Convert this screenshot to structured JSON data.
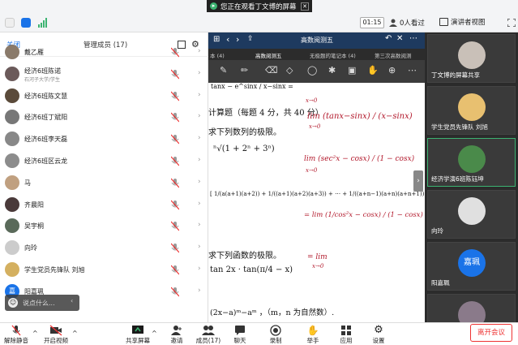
{
  "banner": {
    "text": "您正在观看丁文博的屏幕"
  },
  "topbar": {
    "time": "01:15",
    "viewers": "0人看过",
    "view_mode": "演讲者视图"
  },
  "panel": {
    "close_label": "关闭",
    "title": "管理成员 (17)",
    "members": [
      {
        "name": "戴乙雁",
        "sub": "",
        "avatar_color": "#8a7a6a"
      },
      {
        "name": "经济6班陈诺",
        "sub": "石河子大学/学生",
        "avatar_color": "#6b5a5a"
      },
      {
        "name": "经济6班陈文慧",
        "sub": "",
        "avatar_color": "#5a4a3a"
      },
      {
        "name": "经济6班丁斌阳",
        "sub": "",
        "avatar_color": "#777777"
      },
      {
        "name": "经济6班李天磊",
        "sub": "",
        "avatar_color": "#888888"
      },
      {
        "name": "经济6班区云龙",
        "sub": "",
        "avatar_color": "#8c8c8c"
      },
      {
        "name": "马",
        "sub": "",
        "avatar_color": "#c0a080"
      },
      {
        "name": "齐晨阳",
        "sub": "",
        "avatar_color": "#4a3a3a"
      },
      {
        "name": "吴宇桐",
        "sub": "",
        "avatar_color": "#5a6a5a"
      },
      {
        "name": "向玲",
        "sub": "",
        "avatar_color": "#cccccc"
      },
      {
        "name": "学生党员先锋队 刘旭",
        "sub": "",
        "avatar_color": "#d4b060"
      },
      {
        "name": "阳嘉珮",
        "sub": "",
        "avatar_initial": "嘉",
        "avatar_color": "#1a73e8"
      }
    ],
    "chat_placeholder": "说点什么..."
  },
  "slide": {
    "title": "高数阅测五",
    "tabs": [
      "本 (4)",
      "高数阅测五",
      "无极题的笔记本 (4)",
      "第三次高数阅测"
    ],
    "formula_top": "tanx − e^sinx / x−sinx =",
    "section_heading": "计算题（每题 4 分，共 40 分）",
    "q1": "求下列数列的极限。",
    "q1_expr": "ⁿ√(1 + 2ⁿ + 3ⁿ)",
    "series": "[ 1/(a(a+1)(a+2)) + 1/((a+1)(a+2)(a+3)) + ⋯ + 1/((a+n−1)(a+n)(a+n+1)) ]",
    "q2": "求下列函数的极限。",
    "q2_expr": "tan 2x · tan(π/4 − x)",
    "q3_expr": "(2x−a)ᵐ−aᵐ ，（m，n 为自然数）.",
    "handwriting": {
      "h1": "lim  (tanx−sinx) / (x−sinx)",
      "h1b": "x→0",
      "h2": "lim  (sec²x − cosx) / (1 − cosx)",
      "h2b": "x→0",
      "h3": "= lim  (1/cos²x − cosx) / (1 − cosx)",
      "h4": "= lim",
      "h4b": "x→0",
      "small1": "x→0"
    }
  },
  "videos": [
    {
      "label": "丁文博的屏幕共享",
      "color": "#c9c0b8"
    },
    {
      "label": "学生党员先锋队 刘旭",
      "color": "#e8c070"
    },
    {
      "label": "经济学演6班陈钰坤",
      "color": "#4a8a4a",
      "active": true
    },
    {
      "label": "向玲",
      "color": "#e0e0e0"
    },
    {
      "label": "阳嘉珮",
      "initial": "嘉珮",
      "color": "#1a73e8"
    },
    {
      "label": "",
      "color": "#8a7a8a"
    }
  ],
  "toolbar": {
    "mute": "解除静音",
    "video": "开启视频",
    "share": "共享屏幕",
    "invite": "邀请",
    "members": "成员(17)",
    "chat": "聊天",
    "record": "录制",
    "raise": "举手",
    "apps": "应用",
    "settings": "设置",
    "leave": "离开会议"
  }
}
